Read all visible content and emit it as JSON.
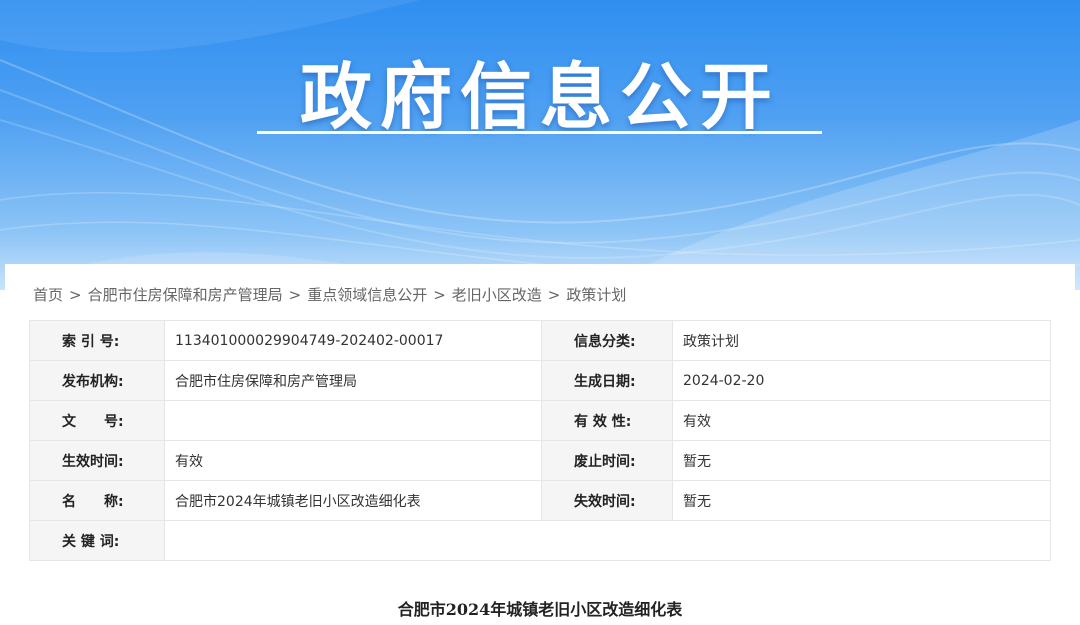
{
  "banner": {
    "title": "政府信息公开"
  },
  "breadcrumb": [
    {
      "label": "首页"
    },
    {
      "label": "合肥市住房保障和房产管理局"
    },
    {
      "label": "重点领域信息公开"
    },
    {
      "label": "老旧小区改造"
    },
    {
      "label": "政策计划"
    }
  ],
  "breadcrumb_sep": ">",
  "meta": {
    "index_label": "索 引 号:",
    "index_value": "113401000029904749-202402-00017",
    "category_label": "信息分类:",
    "category_value": "政策计划",
    "publisher_label": "发布机构:",
    "publisher_value": "合肥市住房保障和房产管理局",
    "date_label": "生成日期:",
    "date_value": "2024-02-20",
    "docno_label": "文　　号:",
    "docno_value": "",
    "validity_label": "有 效 性:",
    "validity_value": "有效",
    "effective_label": "生效时间:",
    "effective_value": "有效",
    "abolish_label": "废止时间:",
    "abolish_value": "暂无",
    "name_label": "名　　称:",
    "name_value": "合肥市2024年城镇老旧小区改造细化表",
    "expire_label": "失效时间:",
    "expire_value": "暂无",
    "keywords_label": "关 键 词:",
    "keywords_value": ""
  },
  "document": {
    "title": "合肥市2024年城镇老旧小区改造细化表"
  }
}
